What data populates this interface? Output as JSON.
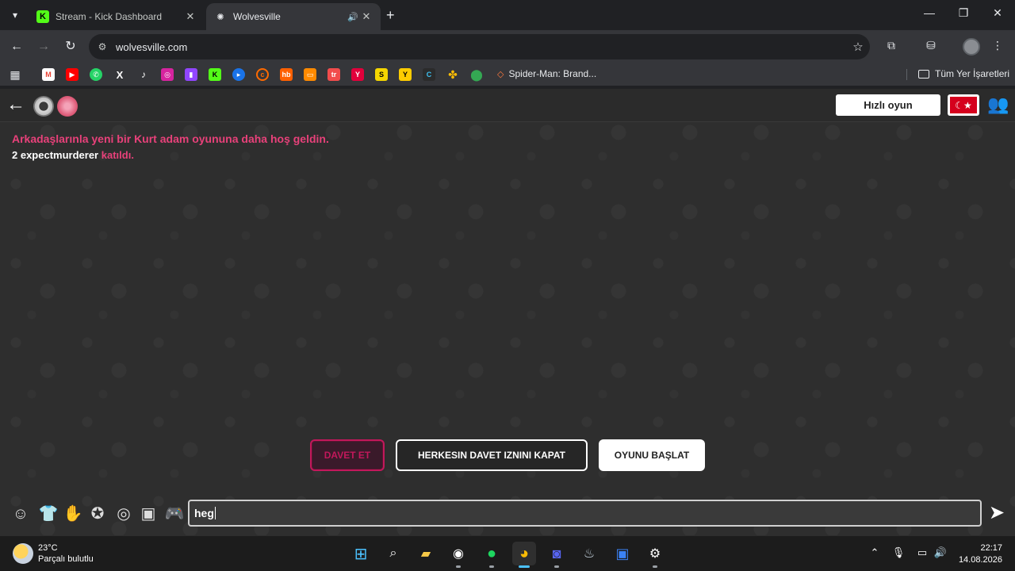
{
  "browser": {
    "tabs": [
      {
        "title": "Stream - Kick Dashboard",
        "favicon": "K"
      },
      {
        "title": "Wolvesville",
        "favicon": "wolf"
      }
    ],
    "url": "wolvesville.com",
    "bookmark_label": "Spider-Man: Brand...",
    "all_bookmarks_label": "Tüm Yer İşaretleri"
  },
  "game": {
    "quick_play": "Hızlı oyun",
    "welcome_message": "Arkadaşlarınla yeni bir Kurt adam oyununa daha hoş geldin.",
    "join_message": {
      "player": "2 expectmurderer",
      "action": "katıldı."
    },
    "buttons": {
      "invite": "DAVET ET",
      "disable_invites": "HERKESIN DAVET IZNINI KAPAT",
      "start_game": "OYUNU BAŞLAT"
    },
    "chat_input_value": "heg",
    "accent_color": "#e8417a"
  },
  "taskbar": {
    "temperature": "23°C",
    "weather_desc": "Parçalı bulutlu",
    "time": "22:17",
    "date": "14.08.2026"
  }
}
